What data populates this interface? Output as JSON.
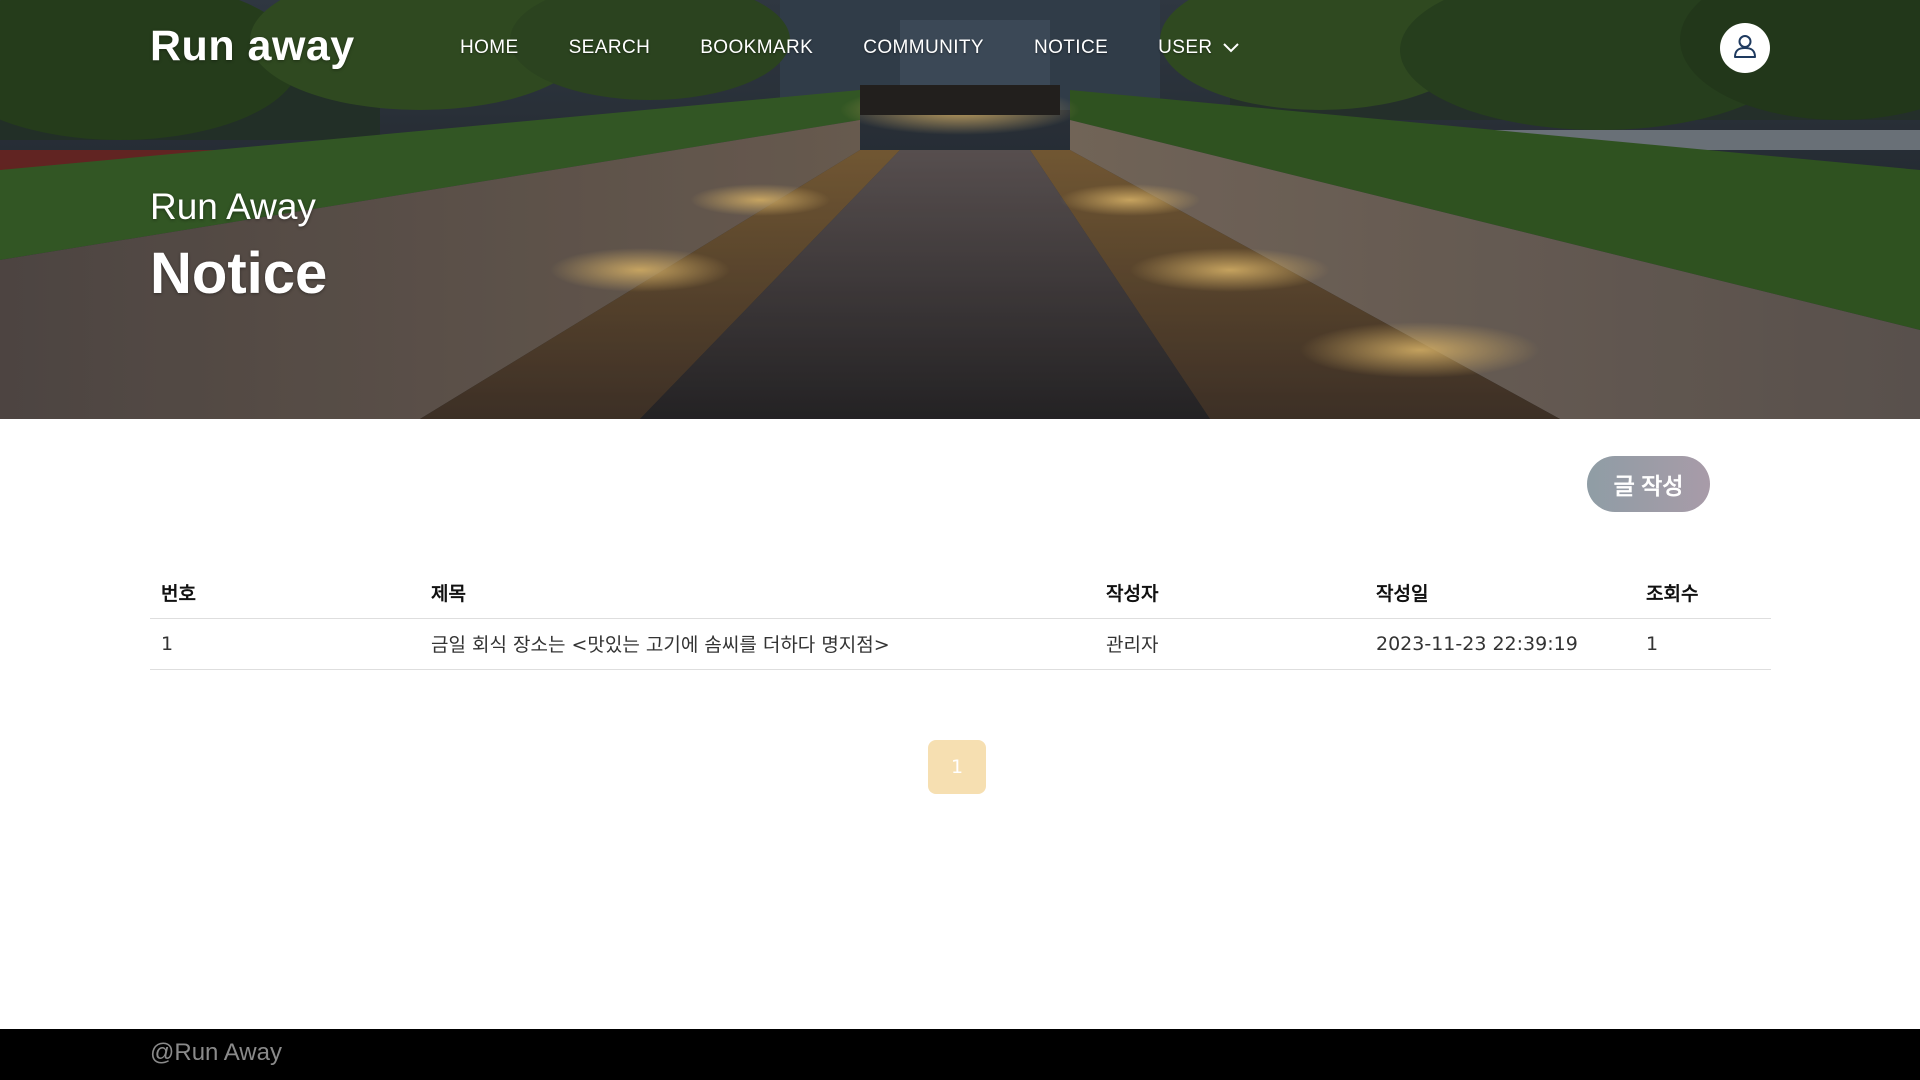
{
  "header": {
    "logo": "Run away",
    "nav": [
      {
        "label": "HOME"
      },
      {
        "label": "SEARCH"
      },
      {
        "label": "BOOKMARK"
      },
      {
        "label": "COMMUNITY"
      },
      {
        "label": "NOTICE"
      },
      {
        "label": "USER",
        "icon": "chevron-down-icon"
      }
    ],
    "user_icon": "user-icon"
  },
  "hero": {
    "subtitle": "Run Away",
    "title": "Notice",
    "image": "city-stream-night"
  },
  "actions": {
    "write_label": "글 작성"
  },
  "table": {
    "columns": [
      "번호",
      "제목",
      "작성자",
      "작성일",
      "조회수"
    ],
    "rows": [
      {
        "no": "1",
        "title": "금일 회식 장소는 <맛있는 고기에 솜씨를 더하다 명지점>",
        "author": "관리자",
        "date": "2023-11-23 22:39:19",
        "views": "1"
      }
    ]
  },
  "pagination": {
    "current": "1"
  },
  "footer": {
    "text": "@Run Away"
  },
  "colors": {
    "pager_bg": "#f6dfb1",
    "write_button": "#969fa8",
    "footer_bg": "#000000"
  }
}
